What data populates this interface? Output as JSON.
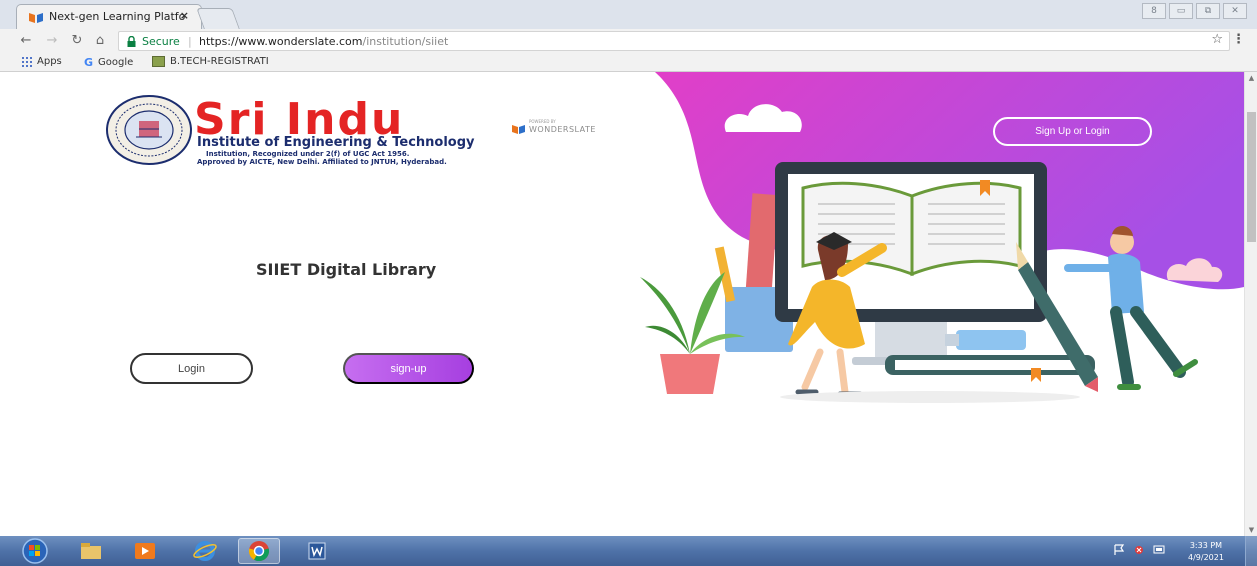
{
  "browser": {
    "tab_title": "Next-gen Learning Platfo",
    "tab_close": "×",
    "window_controls": [
      "8",
      "▭",
      "⧉",
      "✕"
    ],
    "secure_label": "Secure",
    "url_host": "https://www.wonderslate.com",
    "url_path": "/institution/siiet",
    "bookmarks": {
      "apps": "Apps",
      "google": "Google",
      "btech": "B.TECH-REGISTRATI"
    }
  },
  "page": {
    "logo": {
      "title": "Sri Indu",
      "subtitle": "Institute of Engineering & Technology",
      "line1": "Institution, Recognized under 2(f) of UGC Act 1956.",
      "line2": "Approved by AICTE, New Delhi. Affiliated to JNTUH, Hyderabad."
    },
    "wonderslate": {
      "powered_by": "POWERED BY",
      "name": "WONDERSLATE"
    },
    "heading": "SIIET Digital Library",
    "login_button": "Login",
    "signup_button": "sign-up",
    "top_signup_button": "Sign Up or Login",
    "colors": {
      "brand_purple": "#a63fe0",
      "brand_magenta": "#e13fc8",
      "logo_red": "#e42424",
      "logo_navy": "#1c2d6e"
    }
  },
  "taskbar": {
    "time": "3:33 PM",
    "date": "4/9/2021",
    "pinned": [
      "explorer-icon",
      "media-player-icon",
      "internet-explorer-icon",
      "chrome-icon",
      "word-icon"
    ]
  }
}
